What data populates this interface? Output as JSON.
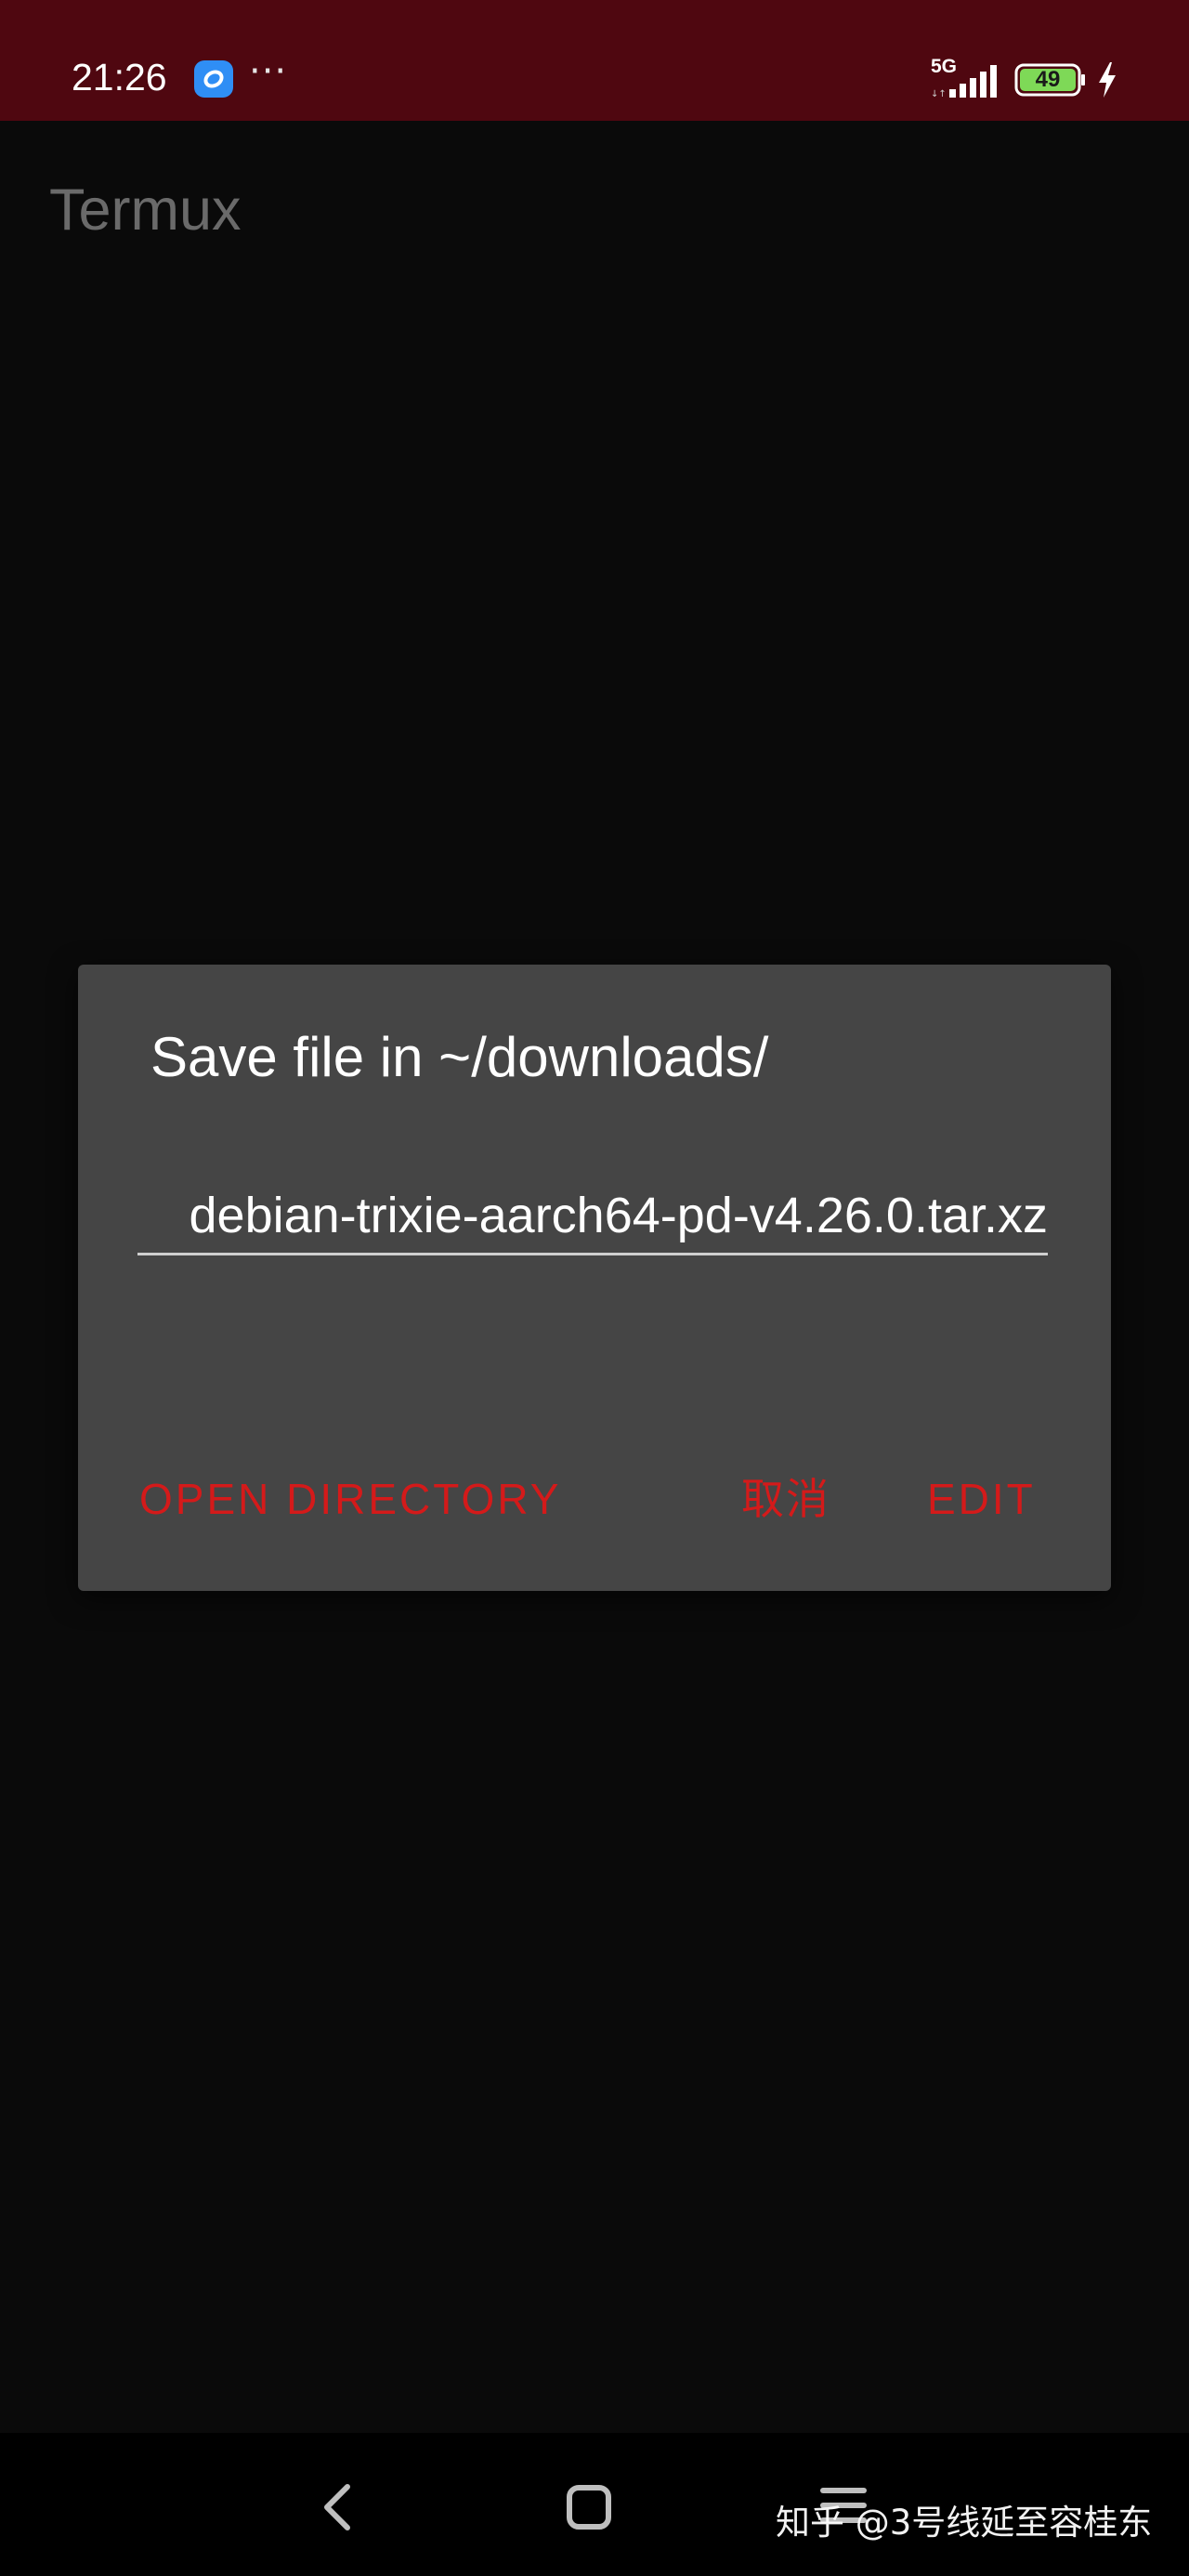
{
  "status_bar": {
    "time": "21:26",
    "more": "···",
    "network_type": "5G",
    "battery_level": "49",
    "bg_color": "#4f0710"
  },
  "app": {
    "title": "Termux"
  },
  "dialog": {
    "title": "Save file in ~/downloads/",
    "filename_value": "debian-trixie-aarch64-pd-v4.26.0.tar.xz",
    "buttons": {
      "open_directory": "OPEN DIRECTORY",
      "cancel": "取消",
      "edit": "EDIT"
    },
    "accent_color": "#d41a1a"
  },
  "watermark": {
    "text": "知乎 @3号线延至容桂东"
  },
  "icons": {
    "app_notification": "browser-app-icon",
    "signal": "signal-bars-icon",
    "battery": "battery-icon",
    "charging": "charging-bolt-icon",
    "nav_back": "back-chevron-icon",
    "nav_home": "home-square-icon",
    "nav_menu": "menu-lines-icon"
  }
}
